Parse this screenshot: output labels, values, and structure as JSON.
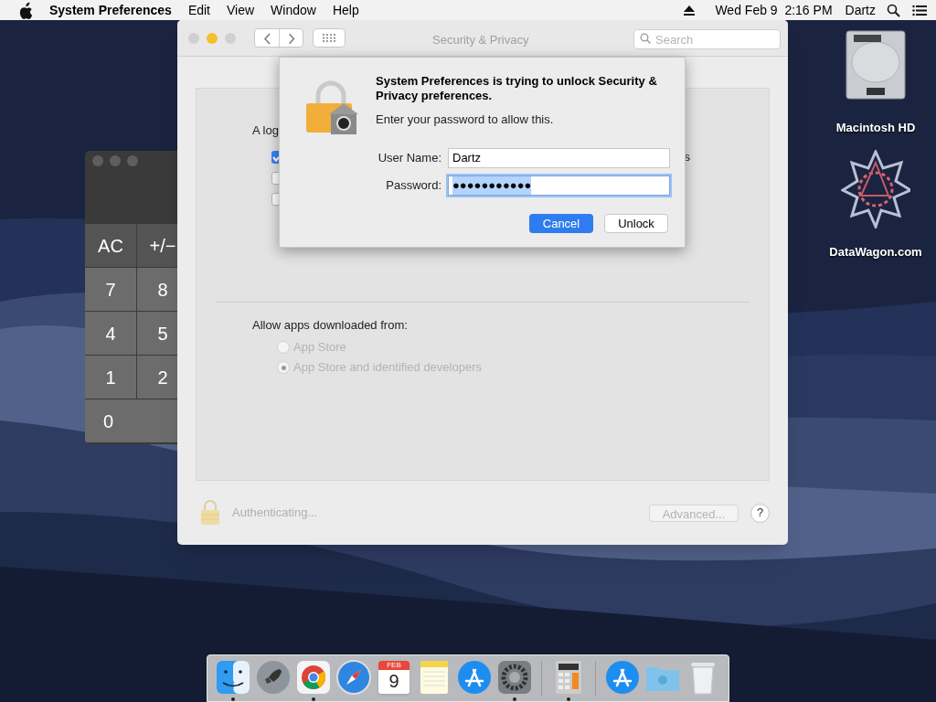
{
  "menu_bar": {
    "app_name": "System Preferences",
    "menus": [
      "Edit",
      "View",
      "Window",
      "Help"
    ],
    "clock": "Wed Feb 9  2:16 PM",
    "user": "Dartz"
  },
  "desktop_icons": [
    {
      "kind": "drive",
      "label": "Macintosh HD"
    },
    {
      "kind": "star",
      "label": "DataWagon.com"
    }
  ],
  "calculator": {
    "keys": [
      {
        "label": "AC",
        "kind": "function"
      },
      {
        "label": "+/−",
        "kind": "function"
      },
      {
        "label": "7",
        "kind": "digit"
      },
      {
        "label": "8",
        "kind": "digit"
      },
      {
        "label": "4",
        "kind": "digit"
      },
      {
        "label": "5",
        "kind": "digit"
      },
      {
        "label": "1",
        "kind": "digit"
      },
      {
        "label": "2",
        "kind": "digit"
      },
      {
        "label": "0",
        "kind": "wide"
      }
    ]
  },
  "prefs_window": {
    "title": "Security & Privacy",
    "search": {
      "placeholder": "Search"
    },
    "general": {
      "label": "A log",
      "checkboxes": [
        {
          "checked": true,
          "label": "s"
        },
        {
          "checked": false
        },
        {
          "checked": false
        }
      ]
    },
    "gatekeeper": {
      "label": "Allow apps downloaded from:",
      "disabled": true,
      "options": [
        {
          "label": "App Store",
          "selected": false
        },
        {
          "label": "App Store and identified developers",
          "selected": true
        }
      ]
    },
    "footer": {
      "status": "Authenticating...",
      "advanced_button": "Advanced...",
      "advanced_disabled": true,
      "help": "?"
    }
  },
  "dialog": {
    "title": "System Preferences is trying to unlock Security & Privacy preferences.",
    "message": "Enter your password to allow this.",
    "fields": [
      {
        "label": "User Name:",
        "value": "Dartz",
        "focused": false,
        "text_selected": false
      },
      {
        "label": "Password:",
        "value": "●●●●●●●●●●●",
        "focused": true,
        "text_selected": true
      }
    ],
    "buttons": [
      {
        "label": "Cancel",
        "default": true
      },
      {
        "label": "Unlock",
        "default": false
      }
    ]
  },
  "dock": {
    "items": [
      {
        "kind": "finder",
        "running": true
      },
      {
        "kind": "rocket",
        "running": false
      },
      {
        "kind": "chrome",
        "running": true
      },
      {
        "kind": "compass",
        "running": false
      },
      {
        "kind": "calendar",
        "month": "FEB",
        "day": "9",
        "running": false
      },
      {
        "kind": "notes",
        "running": false
      },
      {
        "kind": "appstore",
        "running": false
      },
      {
        "kind": "gear",
        "running": true
      },
      {
        "kind": "separator"
      },
      {
        "kind": "calculator",
        "running": true
      },
      {
        "kind": "separator"
      },
      {
        "kind": "appstore",
        "running": false
      },
      {
        "kind": "folder",
        "running": false
      },
      {
        "kind": "trash",
        "running": false
      }
    ]
  }
}
